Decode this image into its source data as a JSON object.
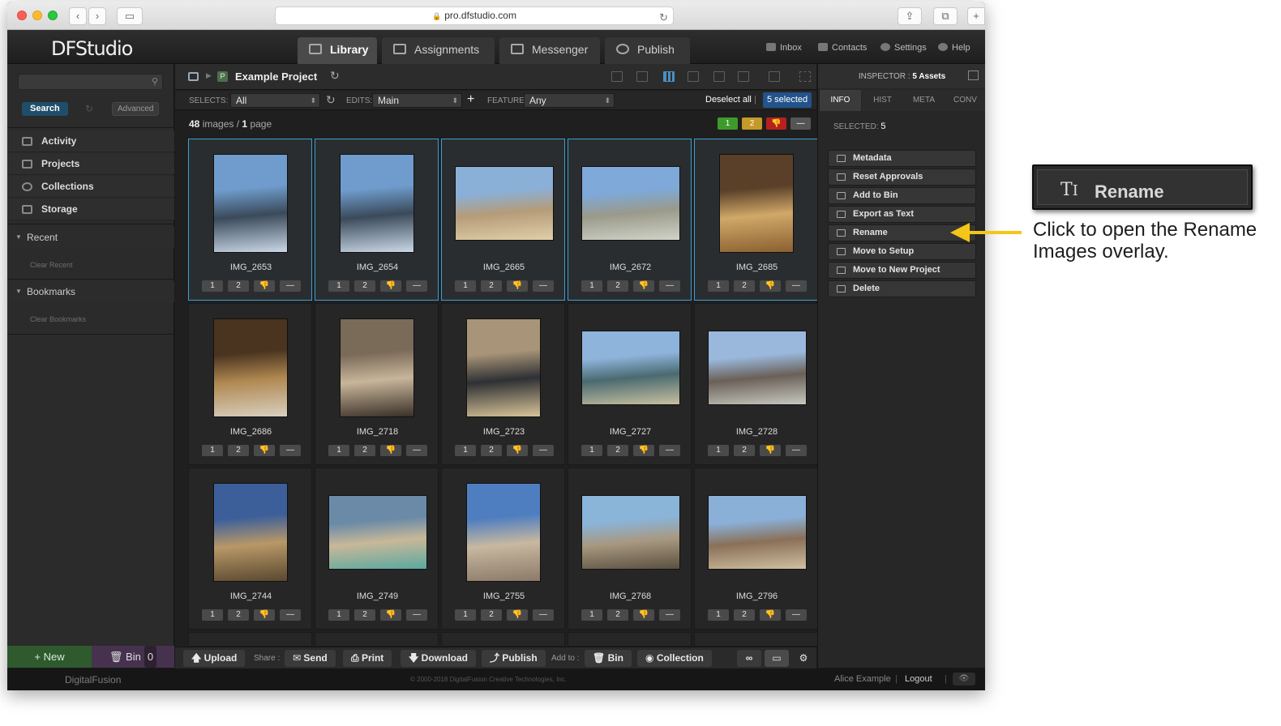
{
  "browser": {
    "url": "pro.dfstudio.com"
  },
  "app": {
    "logo": "DFStudio",
    "tabs": [
      "Library",
      "Assignments",
      "Messenger",
      "Publish"
    ],
    "header_links": [
      "Inbox",
      "Contacts",
      "Settings",
      "Help"
    ]
  },
  "sidebar": {
    "search_label": "Search",
    "advanced_label": "Advanced",
    "items": [
      "Activity",
      "Projects",
      "Collections",
      "Storage"
    ],
    "recent_label": "Recent",
    "clear_recent": "Clear Recent",
    "bookmarks_label": "Bookmarks",
    "clear_bookmarks": "Clear Bookmarks",
    "new_label": "+ New",
    "bin_label": "Bin",
    "bin_count": "0"
  },
  "main": {
    "project_title": "Example Project",
    "selects_label": "SELECTS:",
    "selects_value": "All",
    "edits_label": "EDITS:",
    "edits_value": "Main",
    "feature_label": "FEATURE:",
    "feature_value": "Any",
    "deselect_all": "Deselect all",
    "selected_badge": "5 selected",
    "image_count": "48",
    "images_word": "images",
    "page_count": "1",
    "page_word": "page",
    "flags": [
      "1",
      "2",
      "👎",
      "—"
    ],
    "rate_labels": [
      "1",
      "2",
      "👎",
      "—"
    ],
    "thumbnails": [
      {
        "name": "IMG_2653",
        "selected": true
      },
      {
        "name": "IMG_2654",
        "selected": true
      },
      {
        "name": "IMG_2665",
        "selected": true
      },
      {
        "name": "IMG_2672",
        "selected": true
      },
      {
        "name": "IMG_2685",
        "selected": true
      },
      {
        "name": "IMG_2686",
        "selected": false
      },
      {
        "name": "IMG_2718",
        "selected": false
      },
      {
        "name": "IMG_2723",
        "selected": false
      },
      {
        "name": "IMG_2727",
        "selected": false
      },
      {
        "name": "IMG_2728",
        "selected": false
      },
      {
        "name": "IMG_2744",
        "selected": false
      },
      {
        "name": "IMG_2749",
        "selected": false
      },
      {
        "name": "IMG_2755",
        "selected": false
      },
      {
        "name": "IMG_2768",
        "selected": false
      },
      {
        "name": "IMG_2796",
        "selected": false
      }
    ]
  },
  "action_bar": {
    "upload": "Upload",
    "share_label": "Share :",
    "send": "Send",
    "print": "Print",
    "download": "Download",
    "publish": "Publish",
    "add_to_label": "Add to :",
    "bin": "Bin",
    "collection": "Collection"
  },
  "inspector": {
    "title_prefix": "INSPECTOR :",
    "title_value": "5 Assets",
    "tabs": [
      "INFO",
      "HIST",
      "META",
      "CONV"
    ],
    "selected_label": "SELECTED:",
    "selected_value": "5",
    "actions": [
      "Metadata",
      "Reset Approvals",
      "Add to Bin",
      "Export as Text",
      "Rename",
      "Move to Setup",
      "Move to New Project",
      "Delete"
    ]
  },
  "footer": {
    "logo": "DigitalFusion",
    "copyright": "© 2000-2018 DigitalFusion Creative Technologies, Inc.",
    "user": "Alice Example",
    "logout": "Logout"
  },
  "callout": {
    "label": "Rename",
    "text": "Click to open the Rename Images overlay.",
    "arrow_color": "#f5c518"
  }
}
